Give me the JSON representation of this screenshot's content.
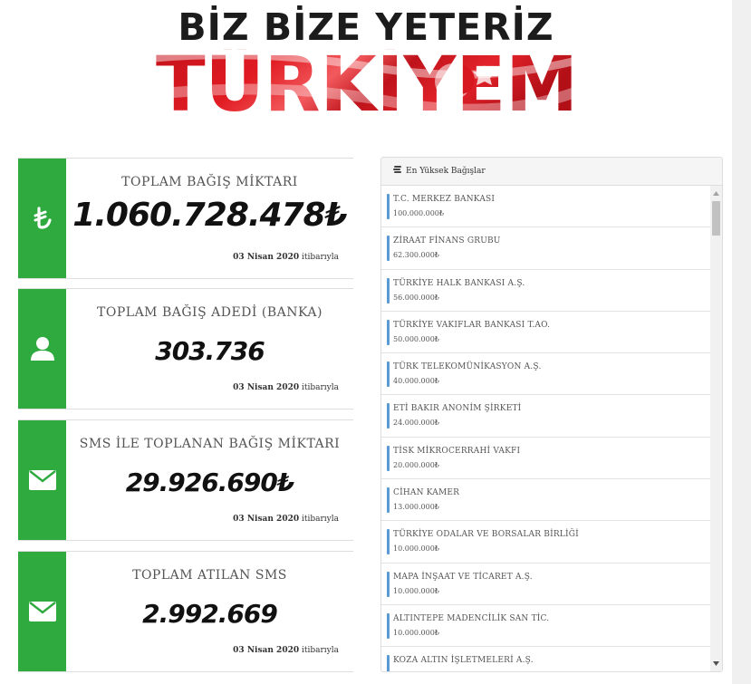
{
  "banner": {
    "headline": "BİZ BİZE YETERİZ",
    "main": "TÜRKİYEM"
  },
  "stats": [
    {
      "icon": "lira-icon",
      "title": "TOPLAM BAĞIŞ MİKTARI",
      "value": "1.060.728.478₺",
      "date": "03 Nisan 2020",
      "suffix": "itibarıyla"
    },
    {
      "icon": "user-icon",
      "title": "TOPLAM BAĞIŞ ADEDİ (BANKA)",
      "value": "303.736",
      "date": "03 Nisan 2020",
      "suffix": "itibarıyla"
    },
    {
      "icon": "envelope-icon",
      "title": "SMS İLE TOPLANAN BAĞIŞ MİKTARI",
      "value": "29.926.690₺",
      "date": "03 Nisan 2020",
      "suffix": "itibarıyla"
    },
    {
      "icon": "envelope-icon",
      "title": "TOPLAM ATILAN SMS",
      "value": "2.992.669",
      "date": "03 Nisan 2020",
      "suffix": "itibarıyla"
    }
  ],
  "donors_panel": {
    "heading": "En Yüksek Bağışlar",
    "items": [
      {
        "name": "T.C. MERKEZ BANKASI",
        "amount": "100.000.000₺"
      },
      {
        "name": "ZİRAAT FİNANS GRUBU",
        "amount": "62.300.000₺"
      },
      {
        "name": "TÜRKİYE HALK BANKASI A.Ş.",
        "amount": "56.000.000₺"
      },
      {
        "name": "TÜRKİYE VAKIFLAR BANKASI T.AO.",
        "amount": "50.000.000₺"
      },
      {
        "name": "TÜRK TELEKOMÜNİKASYON A.Ş.",
        "amount": "40.000.000₺"
      },
      {
        "name": "ETİ BAKIR ANONİM ŞİRKETİ",
        "amount": "24.000.000₺"
      },
      {
        "name": "TİSK MİKROCERRAHİ VAKFI",
        "amount": "20.000.000₺"
      },
      {
        "name": "CİHAN KAMER",
        "amount": "13.000.000₺"
      },
      {
        "name": "TÜRKİYE ODALAR VE BORSALAR BİRLİĞİ",
        "amount": "10.000.000₺"
      },
      {
        "name": "MAPA İNŞAAT VE TİCARET A.Ş.",
        "amount": "10.000.000₺"
      },
      {
        "name": "ALTINTEPE MADENCİLİK SAN TİC.",
        "amount": "10.000.000₺"
      },
      {
        "name": "KOZA ALTIN İŞLETMELERİ A.Ş.",
        "amount": ""
      }
    ]
  },
  "colors": {
    "accent_green": "#2eaa3e",
    "donor_bar": "#5b9bd5",
    "flag_red": "#e11b22"
  }
}
